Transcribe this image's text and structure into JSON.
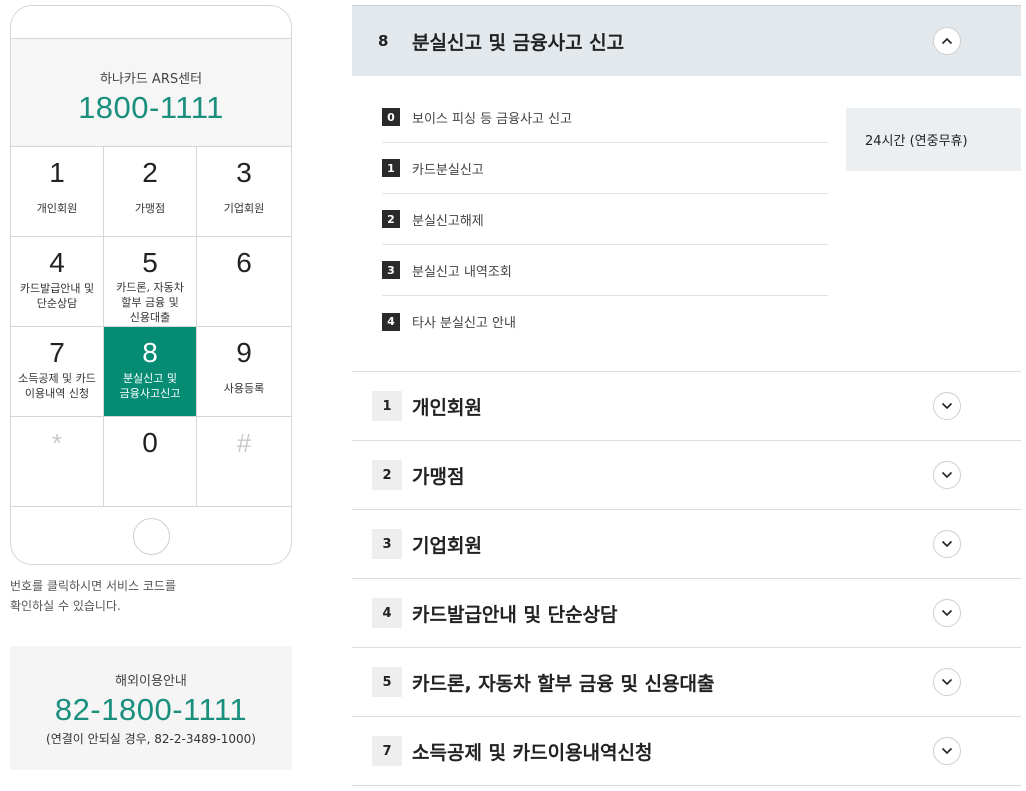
{
  "phone": {
    "display_label": "하나카드 ARS센터",
    "display_number": "1800-1111",
    "keys": [
      {
        "num": "1",
        "label": "개인회원"
      },
      {
        "num": "2",
        "label": "가맹점"
      },
      {
        "num": "3",
        "label": "기업회원"
      },
      {
        "num": "4",
        "label": "카드발급안내 및\n단순상담"
      },
      {
        "num": "5",
        "label": "카드론, 자동차\n할부 금융 및\n신용대출"
      },
      {
        "num": "6",
        "label": ""
      },
      {
        "num": "7",
        "label": "소득공제 및 카드\n이용내역 신청"
      },
      {
        "num": "8",
        "label": "분실신고 및\n금융사고신고"
      },
      {
        "num": "9",
        "label": "사용등록"
      },
      {
        "num": "*",
        "label": ""
      },
      {
        "num": "0",
        "label": ""
      },
      {
        "num": "#",
        "label": ""
      }
    ],
    "active_key": "8",
    "help_text_line1": "번호를 클릭하시면 서비스 코드를",
    "help_text_line2": "확인하실 수 있습니다."
  },
  "overseas": {
    "label": "해외이용안내",
    "number": "82-1800-1111",
    "note": "(연결이 안되실 경우, 82-2-3489-1000)"
  },
  "accordion": {
    "active": {
      "num": "8",
      "title": "분실신고 및 금융사고 신고",
      "sub_items": [
        {
          "num": "0",
          "label": "보이스 피싱 등 금융사고 신고"
        },
        {
          "num": "1",
          "label": "카드분실신고"
        },
        {
          "num": "2",
          "label": "분실신고해제"
        },
        {
          "num": "3",
          "label": "분실신고 내역조회"
        },
        {
          "num": "4",
          "label": "타사 분실신고 안내"
        }
      ],
      "hours": "24시간 (연중무휴)"
    },
    "items": [
      {
        "num": "1",
        "title": "개인회원"
      },
      {
        "num": "2",
        "title": "가맹점"
      },
      {
        "num": "3",
        "title": "기업회원"
      },
      {
        "num": "4",
        "title": "카드발급안내 및 단순상담"
      },
      {
        "num": "5",
        "title": "카드론, 자동차 할부 금융 및 신용대출"
      },
      {
        "num": "7",
        "title": "소득공제 및 카드이용내역신청"
      }
    ]
  },
  "colors": {
    "accent": "#068b75",
    "number_text": "#1a8f7d",
    "active_header_bg": "#e3e8ec"
  },
  "icons": {
    "collapse": "chevron-up-icon",
    "expand": "chevron-down-icon"
  }
}
